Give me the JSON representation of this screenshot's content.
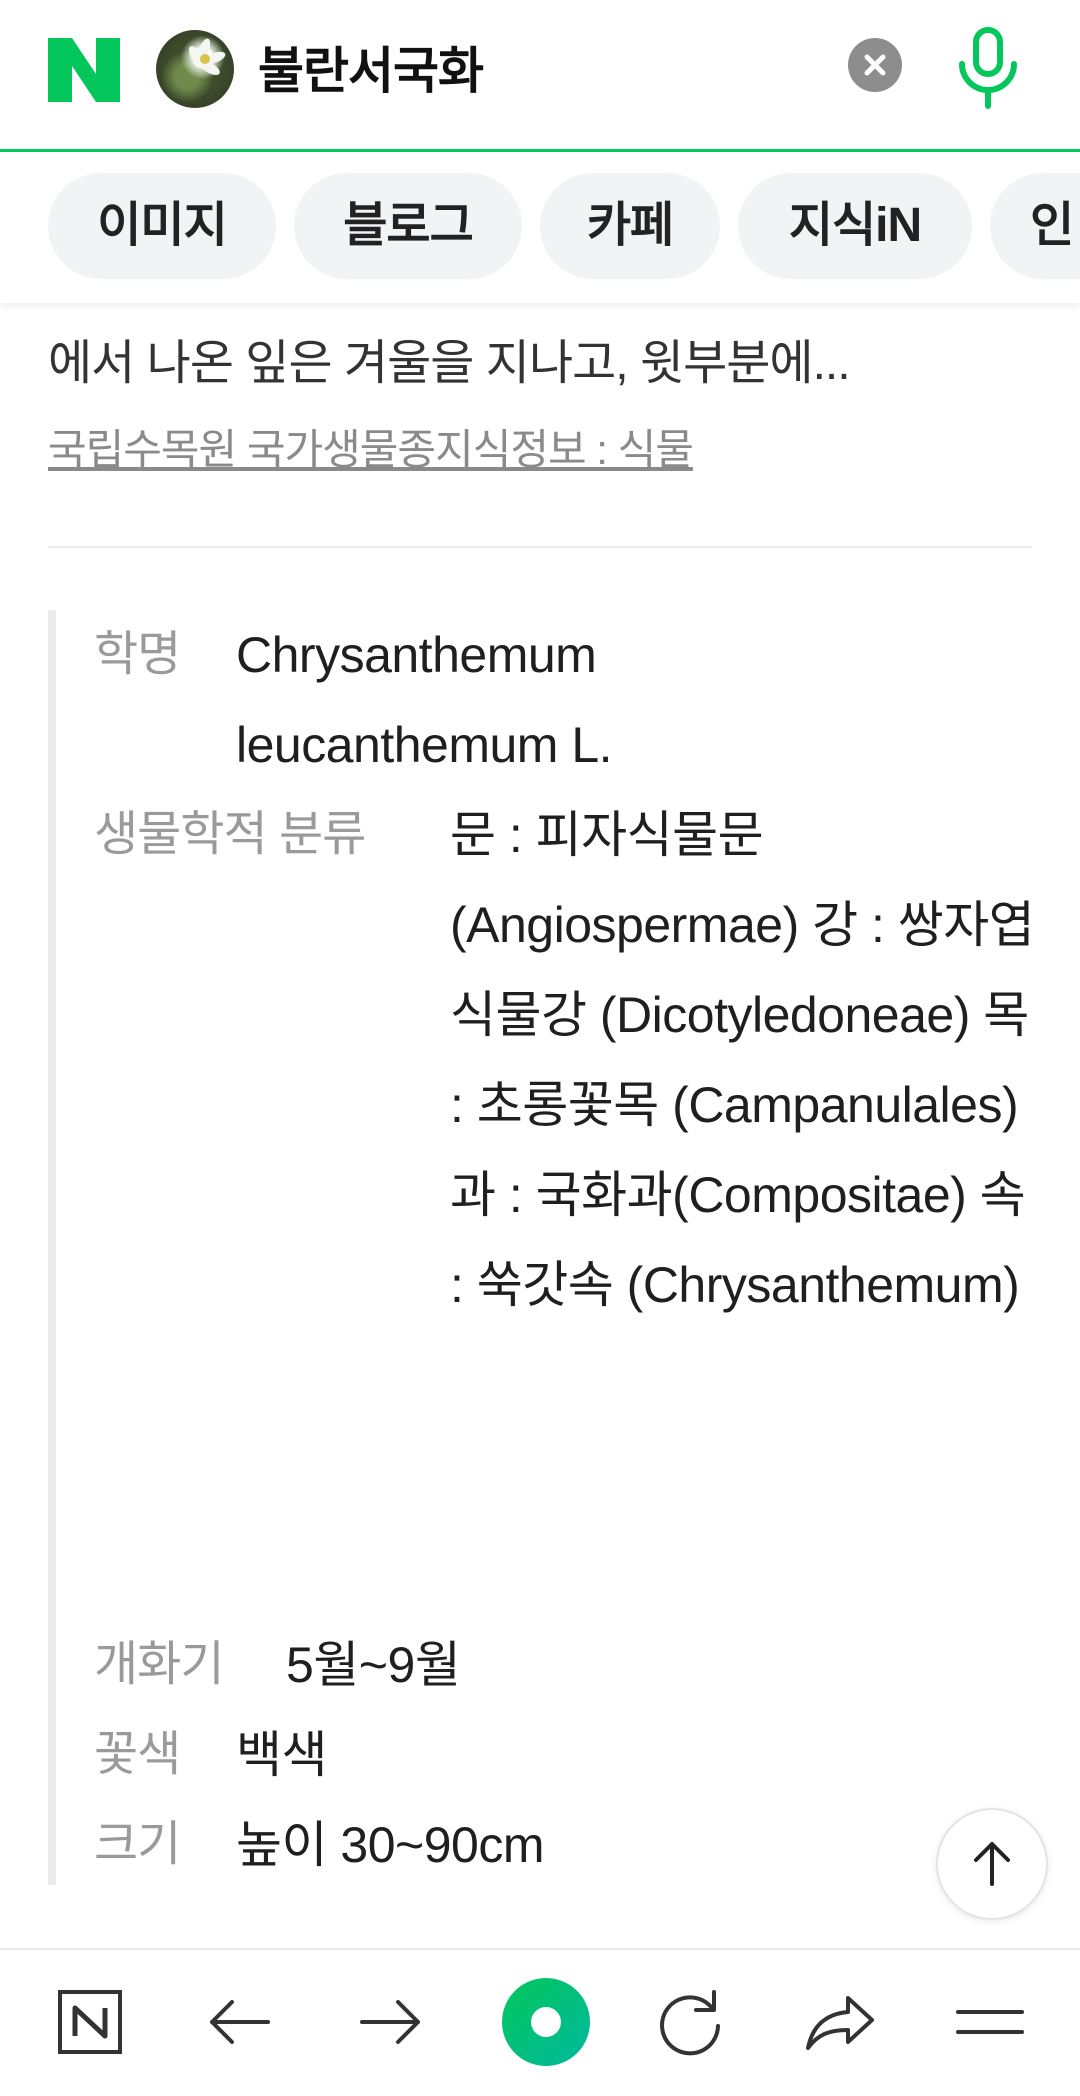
{
  "search": {
    "query": "불란서국화",
    "clear_icon": "close-icon",
    "mic_icon": "microphone-icon",
    "accent_color": "#03c75a"
  },
  "tabs": [
    {
      "label": "이미지"
    },
    {
      "label": "블로그"
    },
    {
      "label": "카페"
    },
    {
      "label": "지식iN"
    },
    {
      "label": "인"
    }
  ],
  "content": {
    "snippet": "에서 나온 잎은 겨울을 지나고, 윗부분에...",
    "source": "국립수목원 국가생물종지식정보 : 식물"
  },
  "info": {
    "scientific_name": {
      "label": "학명",
      "value": "Chrysanthemum leucanthemum L."
    },
    "classification": {
      "label": "생물학적 분류",
      "value": "문 : 피자식물문 (Angiospermae) 강 : 쌍자엽식물강 (Dicotyledoneae) 목 : 초롱꽃목 (Campanulales) 과 : 국화과(Compositae) 속 : 쑥갓속 (Chrysanthemum)"
    },
    "flowering": {
      "label": "개화기",
      "value": "5월~9월"
    },
    "flower_color": {
      "label": "꽃색",
      "value": "백색"
    },
    "size": {
      "label": "크기",
      "value": "높이 30~90cm"
    }
  },
  "toolbar": {
    "items": [
      "naver-home-icon",
      "back-arrow-icon",
      "forward-arrow-icon",
      "green-dot-icon",
      "refresh-icon",
      "share-icon",
      "menu-icon"
    ]
  }
}
